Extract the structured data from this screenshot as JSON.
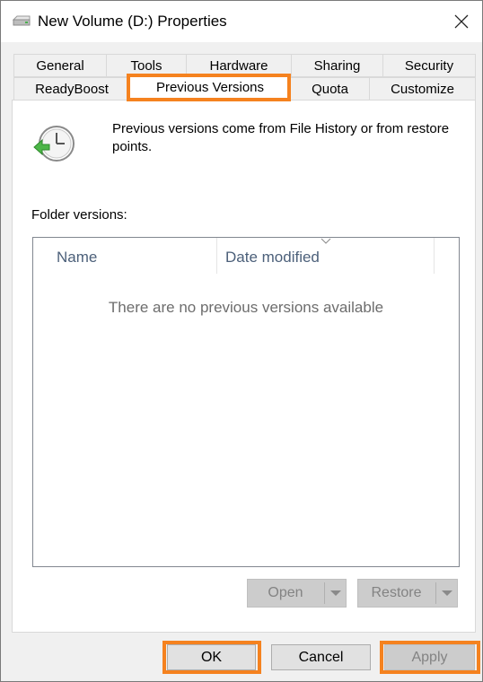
{
  "window": {
    "title": "New Volume (D:) Properties",
    "icon": "drive-icon",
    "close_icon": "close-icon"
  },
  "tabs": {
    "row1": [
      "General",
      "Tools",
      "Hardware",
      "Sharing",
      "Security"
    ],
    "row2": [
      "ReadyBoost",
      "Previous Versions",
      "Quota",
      "Customize"
    ],
    "selected": "Previous Versions"
  },
  "panel": {
    "info_text": "Previous versions come from File History or from restore points.",
    "folder_label": "Folder versions:",
    "list": {
      "columns": [
        "Name",
        "Date modified"
      ],
      "empty_message": "There are no previous versions available"
    },
    "open_label": "Open",
    "restore_label": "Restore"
  },
  "footer": {
    "ok_label": "OK",
    "cancel_label": "Cancel",
    "apply_label": "Apply"
  },
  "colors": {
    "highlight": "#f5821f",
    "disabled_text": "#838383"
  }
}
